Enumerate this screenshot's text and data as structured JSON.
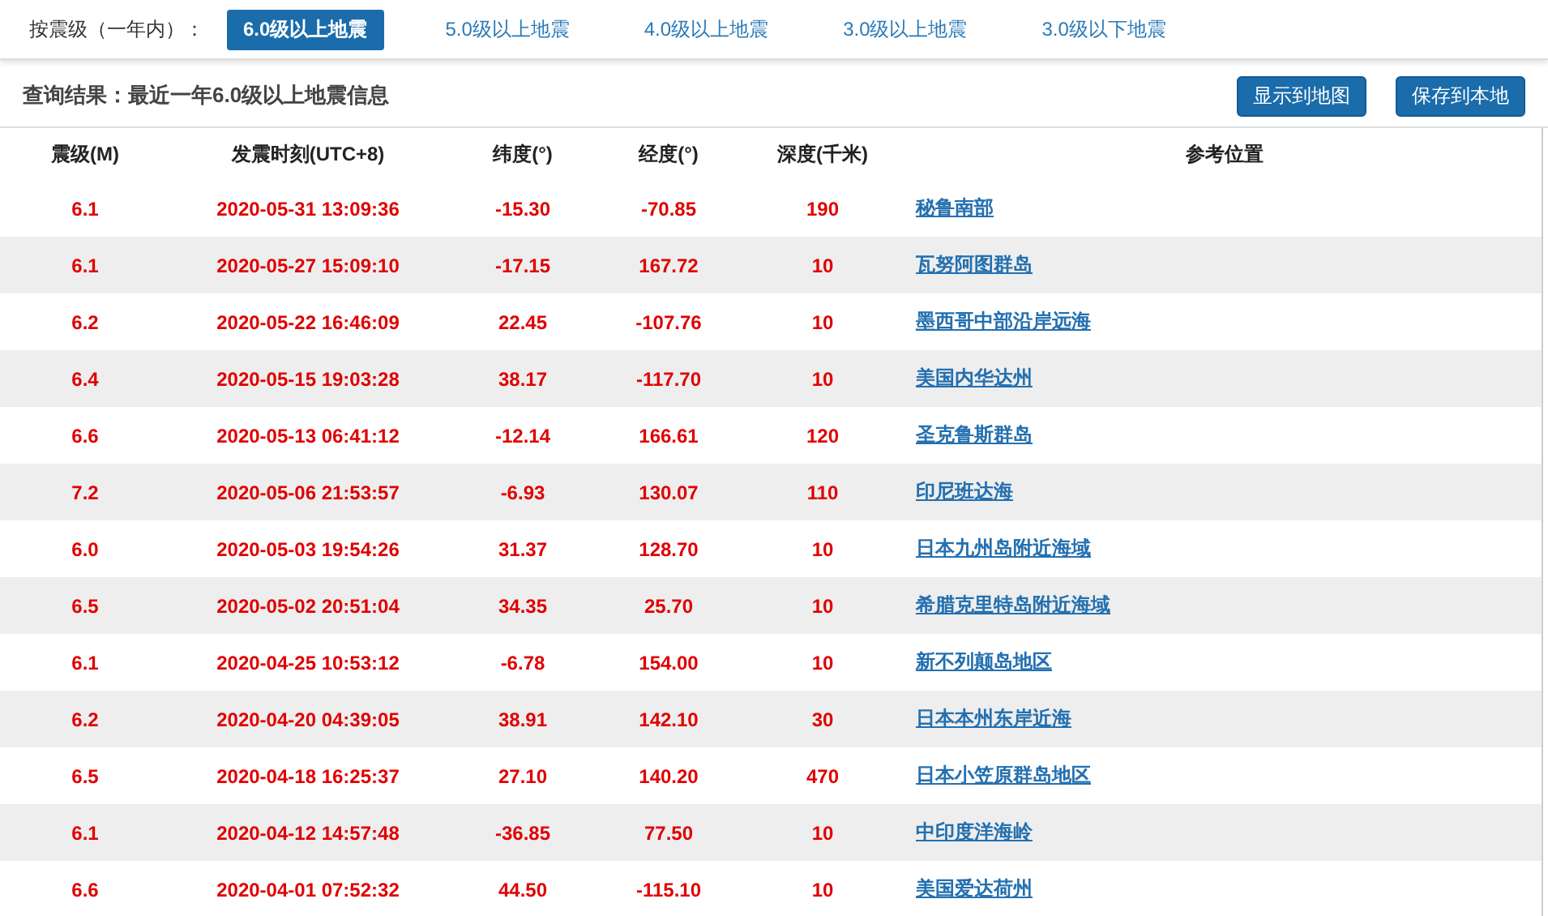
{
  "filter": {
    "label": "按震级（一年内）：",
    "options": [
      {
        "label": "6.0级以上地震",
        "selected": true
      },
      {
        "label": "5.0级以上地震",
        "selected": false
      },
      {
        "label": "4.0级以上地震",
        "selected": false
      },
      {
        "label": "3.0级以上地震",
        "selected": false
      },
      {
        "label": "3.0级以下地震",
        "selected": false
      }
    ]
  },
  "result": {
    "title": "查询结果：最近一年6.0级以上地震信息",
    "buttons": [
      "显示到地图",
      "保存到本地"
    ]
  },
  "table": {
    "columns": [
      "震级(M)",
      "发震时刻(UTC+8)",
      "纬度(°)",
      "经度(°)",
      "深度(千米)",
      "参考位置"
    ],
    "rows": [
      [
        "6.1",
        "2020-05-31 13:09:36",
        "-15.30",
        "-70.85",
        "190",
        "秘鲁南部"
      ],
      [
        "6.1",
        "2020-05-27 15:09:10",
        "-17.15",
        "167.72",
        "10",
        "瓦努阿图群岛"
      ],
      [
        "6.2",
        "2020-05-22 16:46:09",
        "22.45",
        "-107.76",
        "10",
        "墨西哥中部沿岸远海"
      ],
      [
        "6.4",
        "2020-05-15 19:03:28",
        "38.17",
        "-117.70",
        "10",
        "美国内华达州"
      ],
      [
        "6.6",
        "2020-05-13 06:41:12",
        "-12.14",
        "166.61",
        "120",
        "圣克鲁斯群岛"
      ],
      [
        "7.2",
        "2020-05-06 21:53:57",
        "-6.93",
        "130.07",
        "110",
        "印尼班达海"
      ],
      [
        "6.0",
        "2020-05-03 19:54:26",
        "31.37",
        "128.70",
        "10",
        "日本九州岛附近海域"
      ],
      [
        "6.5",
        "2020-05-02 20:51:04",
        "34.35",
        "25.70",
        "10",
        "希腊克里特岛附近海域"
      ],
      [
        "6.1",
        "2020-04-25 10:53:12",
        "-6.78",
        "154.00",
        "10",
        "新不列颠岛地区"
      ],
      [
        "6.2",
        "2020-04-20 04:39:05",
        "38.91",
        "142.10",
        "30",
        "日本本州东岸近海"
      ],
      [
        "6.5",
        "2020-04-18 16:25:37",
        "27.10",
        "140.20",
        "470",
        "日本小笠原群岛地区"
      ],
      [
        "6.1",
        "2020-04-12 14:57:48",
        "-36.85",
        "77.50",
        "10",
        "中印度洋海岭"
      ],
      [
        "6.6",
        "2020-04-01 07:52:32",
        "44.50",
        "-115.10",
        "10",
        "美国爱达荷州"
      ]
    ]
  }
}
